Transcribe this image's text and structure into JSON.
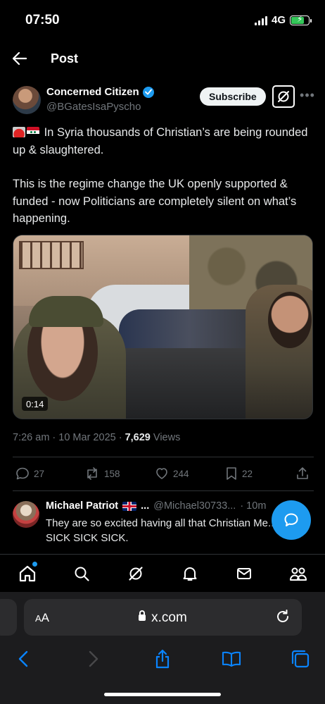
{
  "status_bar": {
    "time": "07:50",
    "network": "4G",
    "battery_level": 0.75
  },
  "header": {
    "title": "Post"
  },
  "author": {
    "name": "Concerned Citizen",
    "handle": "@BGatesIsaPyscho",
    "subscribe_label": "Subscribe",
    "accent": "#1d9bf0"
  },
  "post": {
    "paragraph1": "In Syria thousands of Christian’s are being rounded up & slaughtered.",
    "paragraph2": "This is the regime change the UK openly supported & funded - now Politicians are completely silent on what’s happening.",
    "video_duration": "0:14",
    "timestamp": "7:26 am · 10 Mar 2025 · ",
    "views_count": "7,629",
    "views_label": " Views"
  },
  "actions": {
    "replies": "27",
    "reposts": "158",
    "likes": "244",
    "bookmarks": "22"
  },
  "reply": {
    "name": "Michael Patriot",
    "ellipsis": "...",
    "handle": "@Michael30733...",
    "time": "· 10m",
    "text": "They are so excited having all that Christian Me... SICK SICK SICK."
  },
  "bottom_nav": [
    "home-icon",
    "search-icon",
    "grok-icon",
    "notifications-icon",
    "messages-icon",
    "communities-icon"
  ],
  "browser": {
    "text_size": "AA",
    "url": "x.com"
  }
}
